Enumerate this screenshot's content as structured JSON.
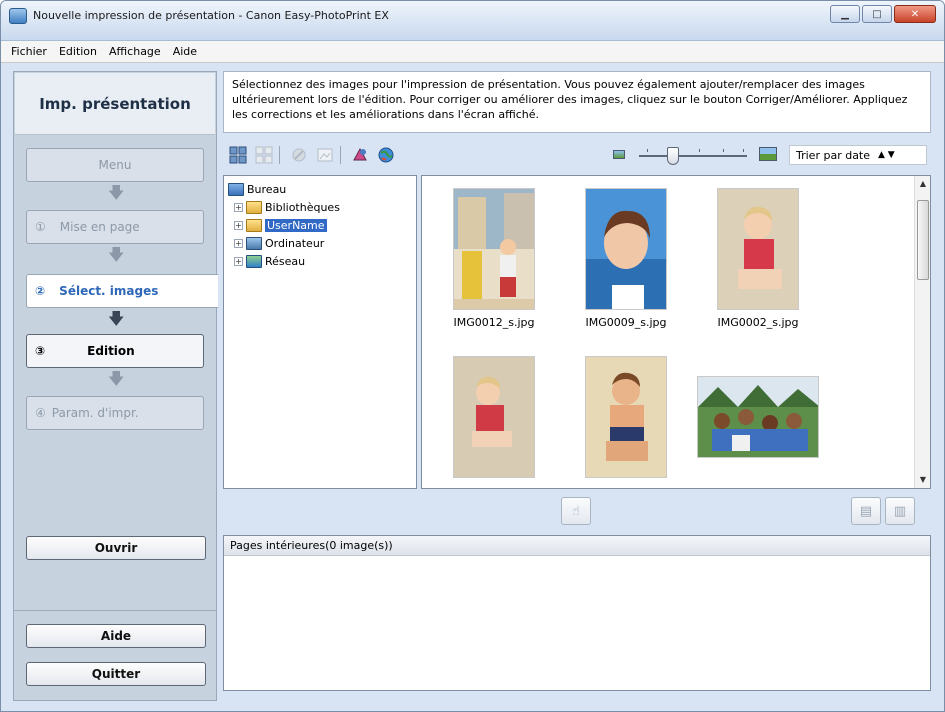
{
  "window": {
    "title": "Nouvelle impression de présentation - Canon Easy-PhotoPrint EX"
  },
  "menu": [
    "Fichier",
    "Edition",
    "Affichage",
    "Aide"
  ],
  "sidebar": {
    "header": "Imp. présentation",
    "menu_label": "Menu",
    "steps": [
      {
        "num": "①",
        "label": "Mise en page",
        "state": "disabled"
      },
      {
        "num": "②",
        "label": "Sélect. images",
        "state": "active"
      },
      {
        "num": "③",
        "label": "Edition",
        "state": "enabled"
      },
      {
        "num": "④",
        "label": "Param. d'impr.",
        "state": "disabled"
      }
    ],
    "open_label": "Ouvrir",
    "help_label": "Aide",
    "quit_label": "Quitter"
  },
  "instructions": "Sélectionnez des images pour l'impression de présentation. Vous pouvez également ajouter/remplacer des images ultérieurement lors de l'édition. Pour corriger ou améliorer des images, cliquez sur le bouton Corriger/Améliorer. Appliquez les corrections et les améliorations dans l'écran affiché.",
  "toolbar": {
    "sort_label": "Trier par date"
  },
  "tree": [
    {
      "label": "Bureau",
      "level": 0
    },
    {
      "label": "Bibliothèques",
      "level": 1
    },
    {
      "label": "UserName",
      "level": 1,
      "selected": true
    },
    {
      "label": "Ordinateur",
      "level": 1
    },
    {
      "label": "Réseau",
      "level": 1
    }
  ],
  "thumbnails": [
    {
      "caption": "IMG0012_s.jpg"
    },
    {
      "caption": "IMG0009_s.jpg"
    },
    {
      "caption": "IMG0002_s.jpg"
    },
    {
      "caption": ""
    },
    {
      "caption": ""
    },
    {
      "caption": ""
    }
  ],
  "pages": {
    "header": "Pages intérieures(0 image(s))"
  },
  "colors": {
    "accent": "#2f68b8",
    "selection": "#3169c6",
    "sidebar_bg": "#c7d2df"
  }
}
